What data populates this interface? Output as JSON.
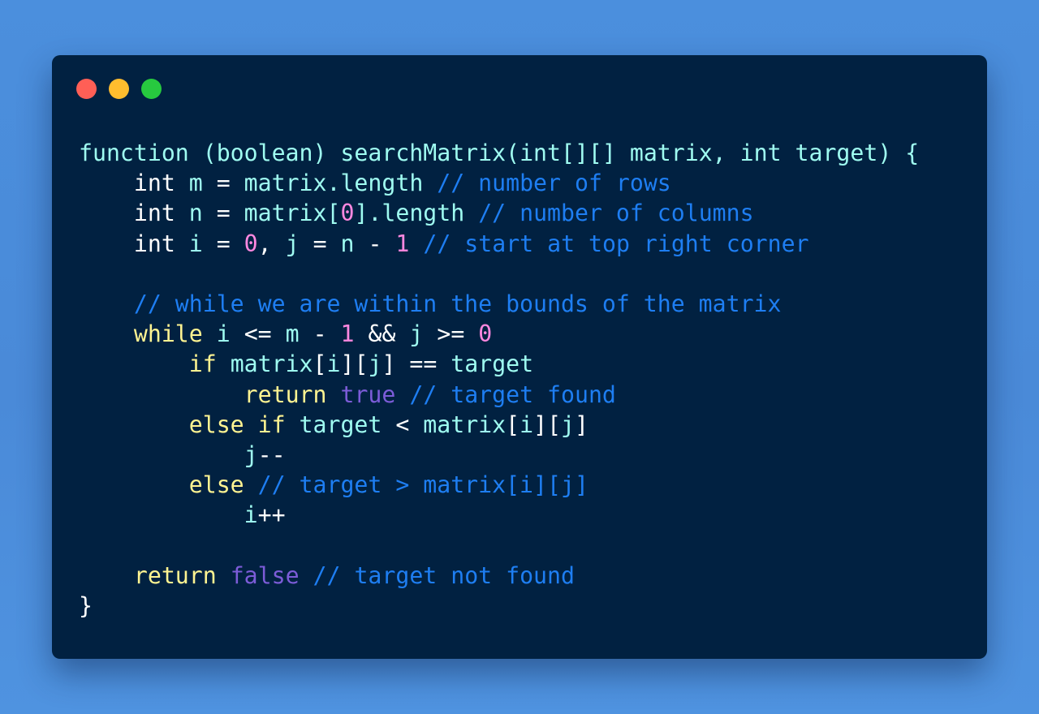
{
  "window": {
    "dots": [
      {
        "name": "close-dot",
        "color": "#ff5f56"
      },
      {
        "name": "minimize-dot",
        "color": "#ffbd2e"
      },
      {
        "name": "maximize-dot",
        "color": "#27c93f"
      }
    ]
  },
  "colors": {
    "plain": "#ffffff",
    "ident": "#9ffcf1",
    "keyword": "#fff492",
    "number": "#ff88e0",
    "literal": "#7c5cd8",
    "comment": "#1e7ef2"
  },
  "code": {
    "lines": [
      [
        {
          "t": "function (boolean) searchMatrix(",
          "c": "ident"
        },
        {
          "t": "int",
          "c": "ident"
        },
        {
          "t": "[][] ",
          "c": "ident"
        },
        {
          "t": "matrix",
          "c": "ident"
        },
        {
          "t": ", ",
          "c": "ident"
        },
        {
          "t": "int",
          "c": "ident"
        },
        {
          "t": " target) {",
          "c": "ident"
        }
      ],
      [
        {
          "t": "    int ",
          "c": "plain"
        },
        {
          "t": "m",
          "c": "ident"
        },
        {
          "t": " = ",
          "c": "plain"
        },
        {
          "t": "matrix.length",
          "c": "ident"
        },
        {
          "t": " // number of rows",
          "c": "comment"
        }
      ],
      [
        {
          "t": "    int ",
          "c": "plain"
        },
        {
          "t": "n",
          "c": "ident"
        },
        {
          "t": " = ",
          "c": "plain"
        },
        {
          "t": "matrix[",
          "c": "ident"
        },
        {
          "t": "0",
          "c": "number"
        },
        {
          "t": "].length",
          "c": "ident"
        },
        {
          "t": " // number of columns",
          "c": "comment"
        }
      ],
      [
        {
          "t": "    int ",
          "c": "plain"
        },
        {
          "t": "i",
          "c": "ident"
        },
        {
          "t": " = ",
          "c": "plain"
        },
        {
          "t": "0",
          "c": "number"
        },
        {
          "t": ", ",
          "c": "plain"
        },
        {
          "t": "j",
          "c": "ident"
        },
        {
          "t": " = ",
          "c": "plain"
        },
        {
          "t": "n",
          "c": "ident"
        },
        {
          "t": " - ",
          "c": "plain"
        },
        {
          "t": "1",
          "c": "number"
        },
        {
          "t": " // start at top right corner",
          "c": "comment"
        }
      ],
      [],
      [
        {
          "t": "    // while we are within the bounds of the matrix",
          "c": "comment"
        }
      ],
      [
        {
          "t": "    ",
          "c": "plain"
        },
        {
          "t": "while",
          "c": "keyword"
        },
        {
          "t": " ",
          "c": "plain"
        },
        {
          "t": "i",
          "c": "ident"
        },
        {
          "t": " <= ",
          "c": "plain"
        },
        {
          "t": "m",
          "c": "ident"
        },
        {
          "t": " - ",
          "c": "plain"
        },
        {
          "t": "1",
          "c": "number"
        },
        {
          "t": " && ",
          "c": "plain"
        },
        {
          "t": "j",
          "c": "ident"
        },
        {
          "t": " >= ",
          "c": "plain"
        },
        {
          "t": "0",
          "c": "number"
        }
      ],
      [
        {
          "t": "        ",
          "c": "plain"
        },
        {
          "t": "if",
          "c": "keyword"
        },
        {
          "t": " ",
          "c": "plain"
        },
        {
          "t": "matrix",
          "c": "ident"
        },
        {
          "t": "[",
          "c": "plain"
        },
        {
          "t": "i",
          "c": "ident"
        },
        {
          "t": "][",
          "c": "plain"
        },
        {
          "t": "j",
          "c": "ident"
        },
        {
          "t": "] == ",
          "c": "plain"
        },
        {
          "t": "target",
          "c": "ident"
        }
      ],
      [
        {
          "t": "            ",
          "c": "plain"
        },
        {
          "t": "return",
          "c": "keyword"
        },
        {
          "t": " ",
          "c": "plain"
        },
        {
          "t": "true",
          "c": "literal"
        },
        {
          "t": " // target found",
          "c": "comment"
        }
      ],
      [
        {
          "t": "        ",
          "c": "plain"
        },
        {
          "t": "else if",
          "c": "keyword"
        },
        {
          "t": " ",
          "c": "plain"
        },
        {
          "t": "target",
          "c": "ident"
        },
        {
          "t": " < ",
          "c": "plain"
        },
        {
          "t": "matrix",
          "c": "ident"
        },
        {
          "t": "[",
          "c": "plain"
        },
        {
          "t": "i",
          "c": "ident"
        },
        {
          "t": "][",
          "c": "plain"
        },
        {
          "t": "j",
          "c": "ident"
        },
        {
          "t": "]",
          "c": "plain"
        }
      ],
      [
        {
          "t": "            ",
          "c": "plain"
        },
        {
          "t": "j",
          "c": "ident"
        },
        {
          "t": "--",
          "c": "plain"
        }
      ],
      [
        {
          "t": "        ",
          "c": "plain"
        },
        {
          "t": "else",
          "c": "keyword"
        },
        {
          "t": " // target > matrix[i][j]",
          "c": "comment"
        }
      ],
      [
        {
          "t": "            ",
          "c": "plain"
        },
        {
          "t": "i",
          "c": "ident"
        },
        {
          "t": "++",
          "c": "plain"
        }
      ],
      [],
      [
        {
          "t": "    ",
          "c": "plain"
        },
        {
          "t": "return",
          "c": "keyword"
        },
        {
          "t": " ",
          "c": "plain"
        },
        {
          "t": "false",
          "c": "literal"
        },
        {
          "t": " // target not found",
          "c": "comment"
        }
      ],
      [
        {
          "t": "}",
          "c": "plain"
        }
      ]
    ]
  }
}
